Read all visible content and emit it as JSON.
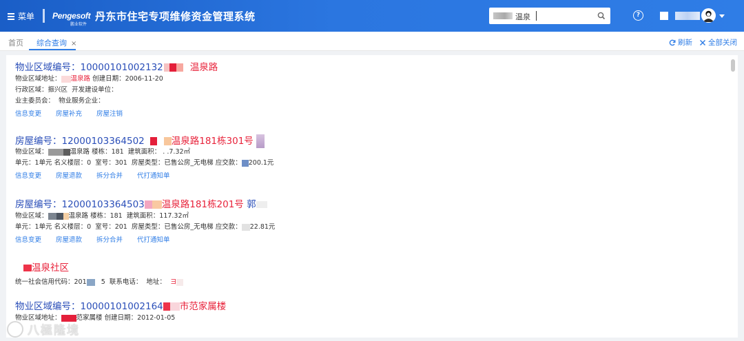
{
  "header": {
    "menu_label": "菜单",
    "logo_text": "Pengesoft",
    "logo_sub": "鹏业软件",
    "system_title": "丹东市住宅专项维修资金管理系统",
    "search_value": "温泉",
    "help_icon": "question-circle-icon",
    "search_icon": "search-icon"
  },
  "tabs": {
    "home": "首页",
    "active": "综合查询",
    "close": "×",
    "refresh": "刷新",
    "close_all": "全部关闭"
  },
  "records": [
    {
      "title_prefix": "物业区域编号：",
      "title_num": "10000101002132",
      "title_tail": "温泉路",
      "line1": {
        "addr_label": "物业区域地址：",
        "addr_tail": "温泉路",
        "created_label": "创建日期：",
        "created": "2006-11-20"
      },
      "line2": {
        "admin_label": "行政区域：",
        "admin": "振兴区",
        "dev_label": "开发建设单位："
      },
      "line3": {
        "owner_label": "业主委员会：",
        "pm_label": "物业服务企业："
      },
      "links": [
        "信息变更",
        "房屋补充",
        "房屋注销"
      ]
    },
    {
      "title_prefix": "房屋编号：",
      "title_num": "12000103364502",
      "title_tail": "温泉路181栋301号",
      "line1": {
        "region_label": "物业区域：",
        "region_tail": "温泉路",
        "bldg_label": "楼栋：",
        "bldg": "181",
        "area_label": "建筑面积：",
        "area": "7.32㎡"
      },
      "line2": {
        "unit_label": "单元：",
        "unit": "1单元",
        "floor_label": "名义楼层：",
        "floor": "0",
        "room_label": "室号：",
        "room": "301",
        "type_label": "房屋类型：",
        "type": "已售公房_无电梯",
        "due_label": "应交款：",
        "due": "200.1元"
      },
      "links": [
        "信息变更",
        "房屋退款",
        "拆分合并",
        "代打通知单"
      ]
    },
    {
      "title_prefix": "房屋编号：",
      "title_num": "12000103364503",
      "title_tail": "温泉路181栋201号",
      "title_extra": "郭",
      "line1": {
        "region_label": "物业区域：",
        "region_tail": "温泉路",
        "bldg_label": "楼栋：",
        "bldg": "181",
        "area_label": "建筑面积：",
        "area": "117.32㎡"
      },
      "line2": {
        "unit_label": "单元：",
        "unit": "1单元",
        "floor_label": "名义楼层：",
        "floor": "0",
        "room_label": "室号：",
        "room": "201",
        "type_label": "房屋类型：",
        "type": "已售公房_无电梯",
        "due_label": "应交款：",
        "due": "22.81元"
      },
      "links": [
        "信息变更",
        "房屋退款",
        "拆分合并",
        "代打通知单"
      ]
    },
    {
      "title_tail": "温泉社区",
      "line1": {
        "credit_label": "统一社会信用代码：",
        "credit": "201",
        "credit_b": "5",
        "phone_label": "联系电话：",
        "addr_label": "地址：",
        "addr": "ヨ"
      }
    },
    {
      "title_prefix": "物业区域编号：",
      "title_num": "10000101002164",
      "title_tail": "市范家属楼",
      "line1": {
        "addr_label": "物业区域地址：",
        "addr_tail": "范家属楼",
        "created_label": "创建日期：",
        "created": "2012-01-05"
      }
    }
  ],
  "watermark": "八極隆境",
  "colors": {
    "header": "#2b76e0",
    "link": "#2f7de6",
    "title": "#2a4eb8",
    "highlight": "#e8233b"
  }
}
